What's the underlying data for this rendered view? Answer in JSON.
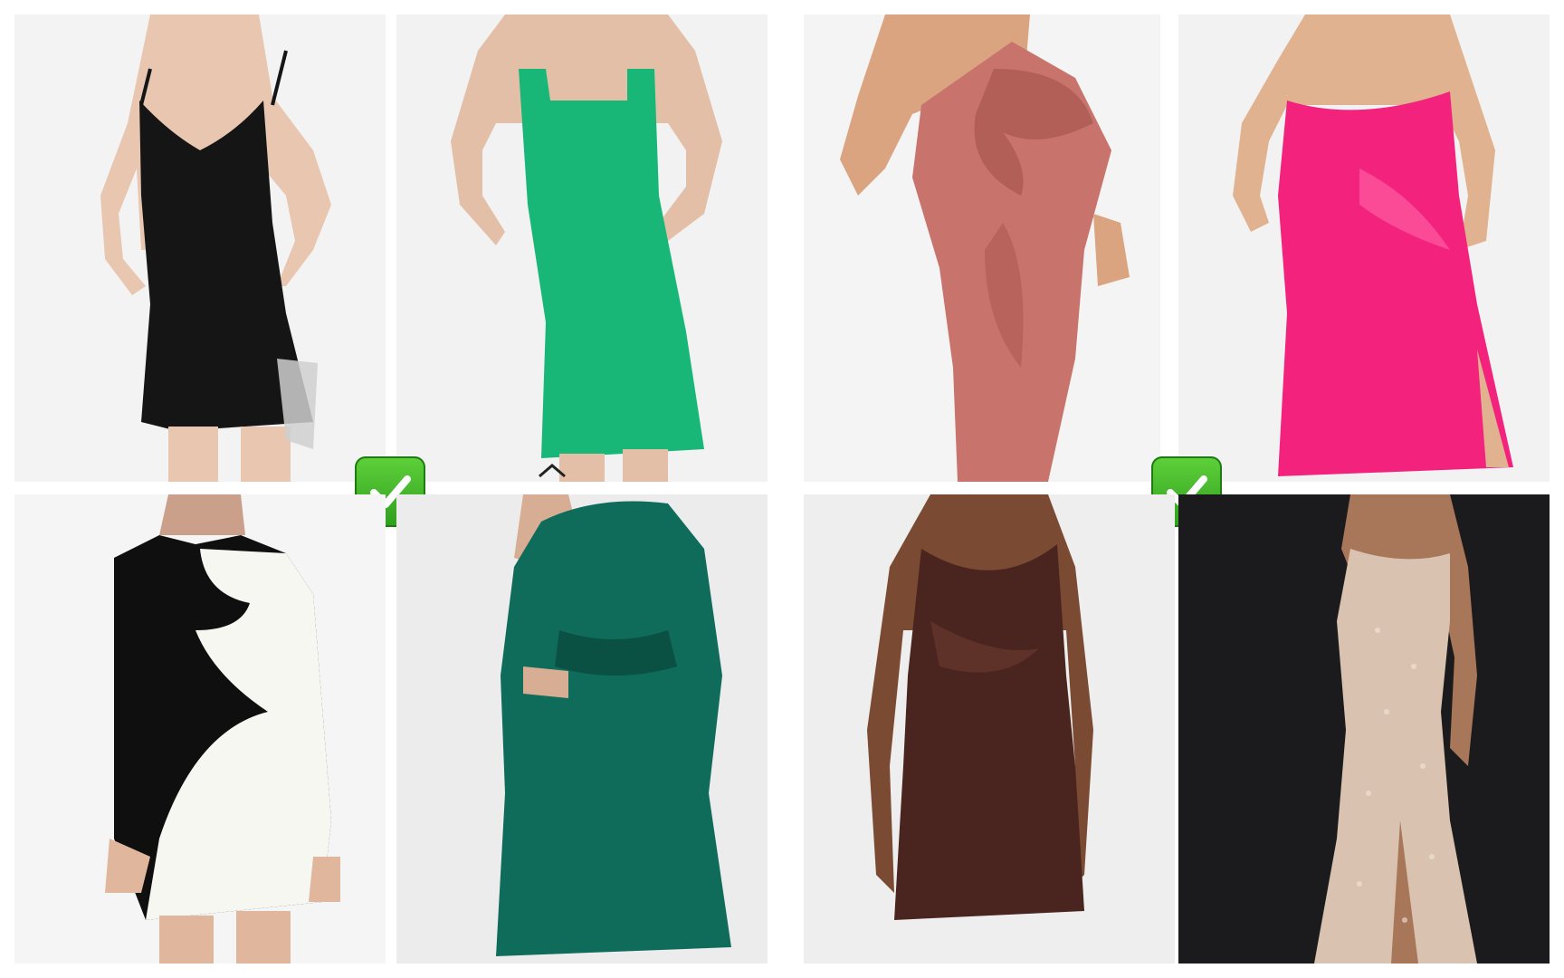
{
  "title": "",
  "colors": {
    "page_background": "#ffffff",
    "check_green": "#3cb62a",
    "dress_black": "#151515",
    "dress_green": "#19b777",
    "dress_pink_rose": "#c8736b",
    "dress_hot_pink": "#f2227d",
    "dress_black_white_block": "#0f0f0f",
    "dress_teal_satin": "#0f6b5a",
    "dress_brown_slip": "#4a241f",
    "dress_champagne_sequin": "#d9c3b0",
    "dark_studio_background": "#1b1b1d"
  },
  "panels": [
    {
      "id": "black-slip-dress",
      "icon": "dress-photo"
    },
    {
      "id": "green-square-neck-dress",
      "icon": "dress-photo"
    },
    {
      "id": "rose-one-shoulder-dress",
      "icon": "dress-photo"
    },
    {
      "id": "hot-pink-satin-dress",
      "icon": "dress-photo"
    },
    {
      "id": "black-white-colorblock-dress",
      "icon": "dress-photo"
    },
    {
      "id": "teal-satin-long-sleeve-dress",
      "icon": "dress-photo"
    },
    {
      "id": "brown-satin-slip-dress",
      "icon": "dress-photo"
    },
    {
      "id": "champagne-sequin-dress",
      "icon": "dress-photo"
    }
  ],
  "badges": [
    {
      "icon": "check-mark-icon"
    },
    {
      "icon": "check-mark-icon"
    }
  ]
}
